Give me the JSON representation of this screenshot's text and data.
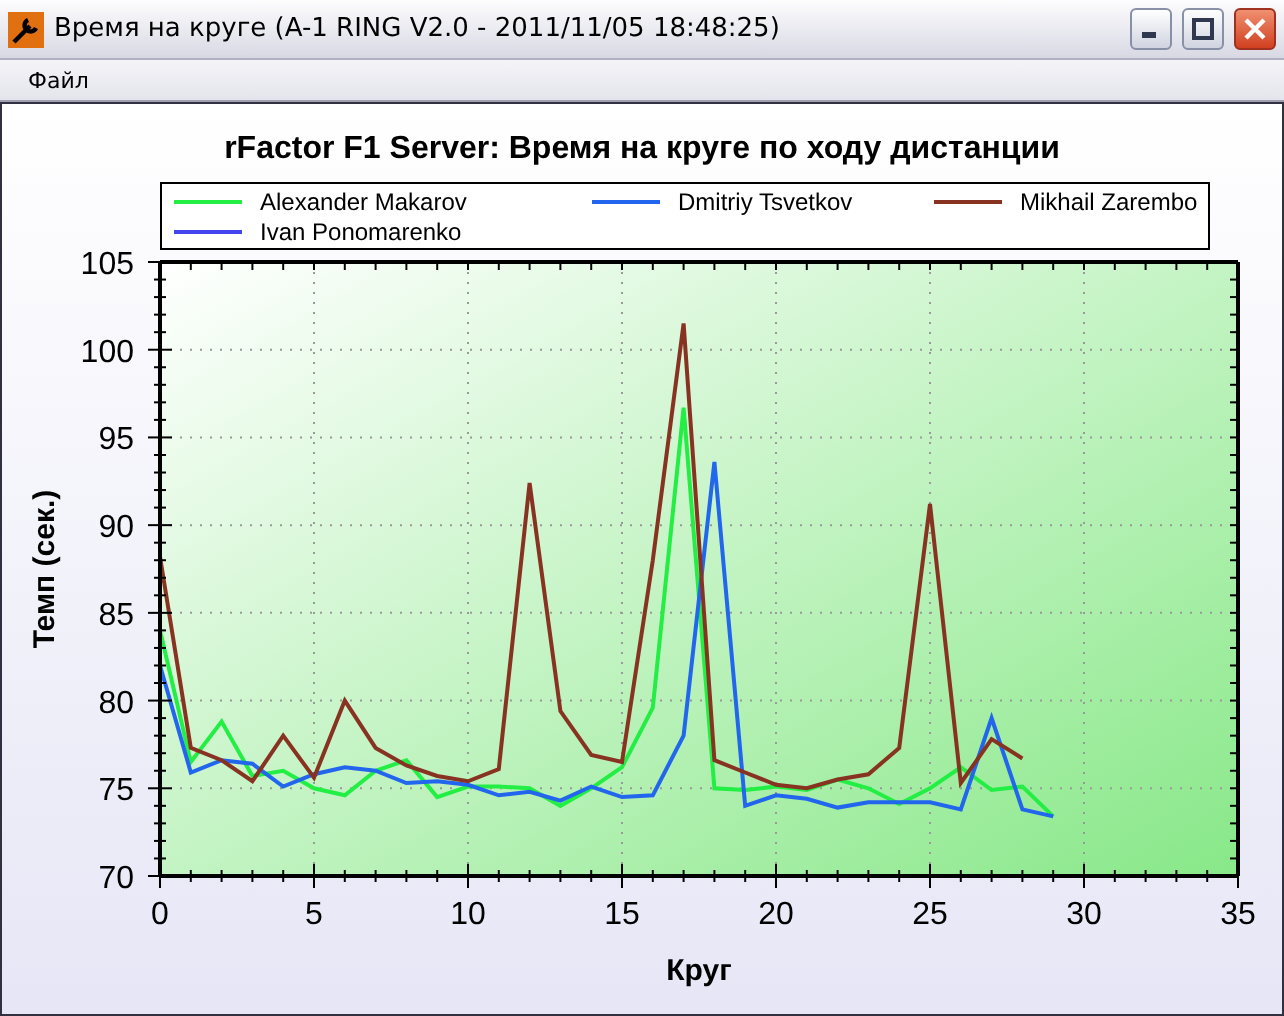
{
  "window": {
    "title": "Время на круге (A-1 RING V2.0 - 2011/11/05 18:48:25)"
  },
  "menu": [
    "Файл"
  ],
  "chart": {
    "chart_data": {
      "type": "line",
      "title": "rFactor F1 Server: Время на круге по ходу дистанции",
      "xlabel": "Круг",
      "ylabel": "Темп (сек.)",
      "xlim": [
        0,
        35
      ],
      "ylim": [
        70,
        105
      ],
      "grid": true,
      "legend": true,
      "xticks": [
        0,
        5,
        10,
        15,
        20,
        25,
        30,
        35
      ],
      "yticks": [
        70,
        75,
        80,
        85,
        90,
        95,
        100,
        105
      ],
      "x": [
        0,
        1,
        2,
        3,
        4,
        5,
        6,
        7,
        8,
        9,
        10,
        11,
        12,
        13,
        14,
        15,
        16,
        17,
        18,
        19,
        20,
        21,
        22,
        23,
        24,
        25,
        26,
        27,
        28,
        29
      ],
      "series": [
        {
          "name": "Alexander Makarov",
          "color": "#22ee44",
          "values": [
            84,
            76.5,
            78.8,
            75.7,
            76,
            75,
            74.6,
            76,
            76.6,
            74.5,
            75.1,
            75.1,
            75,
            74,
            75,
            76.2,
            79.6,
            96.7,
            75,
            74.9,
            75.1,
            74.9,
            75.5,
            75,
            74.1,
            75,
            76.2,
            74.9,
            75.1,
            73.4
          ]
        },
        {
          "name": "Dmitriy Tsvetkov",
          "color": "#2266ee",
          "values": [
            82,
            75.9,
            76.6,
            76.4,
            75.1,
            75.8,
            76.2,
            76,
            75.3,
            75.4,
            75.2,
            74.6,
            74.8,
            74.3,
            75.1,
            74.5,
            74.6,
            78,
            93.6,
            74,
            74.6,
            74.4,
            73.9,
            74.2,
            74.2,
            74.2,
            73.8,
            79,
            73.8,
            73.4
          ]
        },
        {
          "name": "Mikhail Zarembo",
          "color": "#883322",
          "values": [
            88.2,
            77.3,
            76.6,
            75.4,
            78,
            75.6,
            80,
            77.3,
            76.3,
            75.7,
            75.4,
            76.1,
            92.4,
            79.4,
            76.9,
            76.5,
            88,
            101.5,
            76.6,
            75.9,
            75.2,
            75,
            75.5,
            75.8,
            77.3,
            91.2,
            75.3,
            77.8,
            76.7,
            null
          ]
        },
        {
          "name": "Ivan Ponomarenko",
          "color": "#4444ee",
          "values": [
            null,
            null,
            null,
            null,
            null,
            null,
            null,
            null,
            null,
            null,
            null,
            null,
            null,
            null,
            null,
            null,
            null,
            null,
            null,
            null,
            null,
            null,
            null,
            null,
            null,
            null,
            null,
            null,
            null,
            null
          ]
        }
      ]
    }
  }
}
